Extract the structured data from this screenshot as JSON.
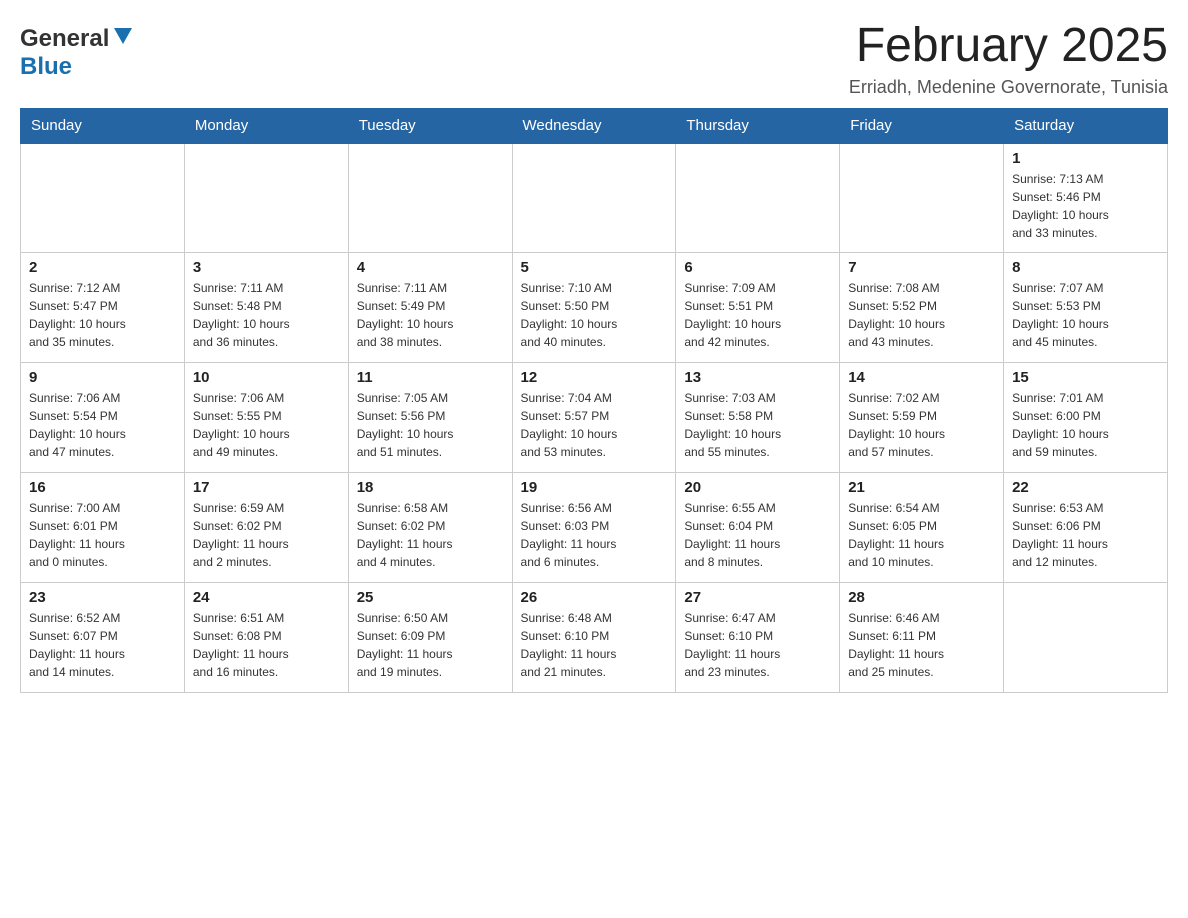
{
  "header": {
    "title": "February 2025",
    "subtitle": "Erriadh, Medenine Governorate, Tunisia",
    "logo_general": "General",
    "logo_blue": "Blue"
  },
  "weekdays": [
    "Sunday",
    "Monday",
    "Tuesday",
    "Wednesday",
    "Thursday",
    "Friday",
    "Saturday"
  ],
  "weeks": [
    [
      {
        "day": "",
        "info": ""
      },
      {
        "day": "",
        "info": ""
      },
      {
        "day": "",
        "info": ""
      },
      {
        "day": "",
        "info": ""
      },
      {
        "day": "",
        "info": ""
      },
      {
        "day": "",
        "info": ""
      },
      {
        "day": "1",
        "info": "Sunrise: 7:13 AM\nSunset: 5:46 PM\nDaylight: 10 hours\nand 33 minutes."
      }
    ],
    [
      {
        "day": "2",
        "info": "Sunrise: 7:12 AM\nSunset: 5:47 PM\nDaylight: 10 hours\nand 35 minutes."
      },
      {
        "day": "3",
        "info": "Sunrise: 7:11 AM\nSunset: 5:48 PM\nDaylight: 10 hours\nand 36 minutes."
      },
      {
        "day": "4",
        "info": "Sunrise: 7:11 AM\nSunset: 5:49 PM\nDaylight: 10 hours\nand 38 minutes."
      },
      {
        "day": "5",
        "info": "Sunrise: 7:10 AM\nSunset: 5:50 PM\nDaylight: 10 hours\nand 40 minutes."
      },
      {
        "day": "6",
        "info": "Sunrise: 7:09 AM\nSunset: 5:51 PM\nDaylight: 10 hours\nand 42 minutes."
      },
      {
        "day": "7",
        "info": "Sunrise: 7:08 AM\nSunset: 5:52 PM\nDaylight: 10 hours\nand 43 minutes."
      },
      {
        "day": "8",
        "info": "Sunrise: 7:07 AM\nSunset: 5:53 PM\nDaylight: 10 hours\nand 45 minutes."
      }
    ],
    [
      {
        "day": "9",
        "info": "Sunrise: 7:06 AM\nSunset: 5:54 PM\nDaylight: 10 hours\nand 47 minutes."
      },
      {
        "day": "10",
        "info": "Sunrise: 7:06 AM\nSunset: 5:55 PM\nDaylight: 10 hours\nand 49 minutes."
      },
      {
        "day": "11",
        "info": "Sunrise: 7:05 AM\nSunset: 5:56 PM\nDaylight: 10 hours\nand 51 minutes."
      },
      {
        "day": "12",
        "info": "Sunrise: 7:04 AM\nSunset: 5:57 PM\nDaylight: 10 hours\nand 53 minutes."
      },
      {
        "day": "13",
        "info": "Sunrise: 7:03 AM\nSunset: 5:58 PM\nDaylight: 10 hours\nand 55 minutes."
      },
      {
        "day": "14",
        "info": "Sunrise: 7:02 AM\nSunset: 5:59 PM\nDaylight: 10 hours\nand 57 minutes."
      },
      {
        "day": "15",
        "info": "Sunrise: 7:01 AM\nSunset: 6:00 PM\nDaylight: 10 hours\nand 59 minutes."
      }
    ],
    [
      {
        "day": "16",
        "info": "Sunrise: 7:00 AM\nSunset: 6:01 PM\nDaylight: 11 hours\nand 0 minutes."
      },
      {
        "day": "17",
        "info": "Sunrise: 6:59 AM\nSunset: 6:02 PM\nDaylight: 11 hours\nand 2 minutes."
      },
      {
        "day": "18",
        "info": "Sunrise: 6:58 AM\nSunset: 6:02 PM\nDaylight: 11 hours\nand 4 minutes."
      },
      {
        "day": "19",
        "info": "Sunrise: 6:56 AM\nSunset: 6:03 PM\nDaylight: 11 hours\nand 6 minutes."
      },
      {
        "day": "20",
        "info": "Sunrise: 6:55 AM\nSunset: 6:04 PM\nDaylight: 11 hours\nand 8 minutes."
      },
      {
        "day": "21",
        "info": "Sunrise: 6:54 AM\nSunset: 6:05 PM\nDaylight: 11 hours\nand 10 minutes."
      },
      {
        "day": "22",
        "info": "Sunrise: 6:53 AM\nSunset: 6:06 PM\nDaylight: 11 hours\nand 12 minutes."
      }
    ],
    [
      {
        "day": "23",
        "info": "Sunrise: 6:52 AM\nSunset: 6:07 PM\nDaylight: 11 hours\nand 14 minutes."
      },
      {
        "day": "24",
        "info": "Sunrise: 6:51 AM\nSunset: 6:08 PM\nDaylight: 11 hours\nand 16 minutes."
      },
      {
        "day": "25",
        "info": "Sunrise: 6:50 AM\nSunset: 6:09 PM\nDaylight: 11 hours\nand 19 minutes."
      },
      {
        "day": "26",
        "info": "Sunrise: 6:48 AM\nSunset: 6:10 PM\nDaylight: 11 hours\nand 21 minutes."
      },
      {
        "day": "27",
        "info": "Sunrise: 6:47 AM\nSunset: 6:10 PM\nDaylight: 11 hours\nand 23 minutes."
      },
      {
        "day": "28",
        "info": "Sunrise: 6:46 AM\nSunset: 6:11 PM\nDaylight: 11 hours\nand 25 minutes."
      },
      {
        "day": "",
        "info": ""
      }
    ]
  ]
}
